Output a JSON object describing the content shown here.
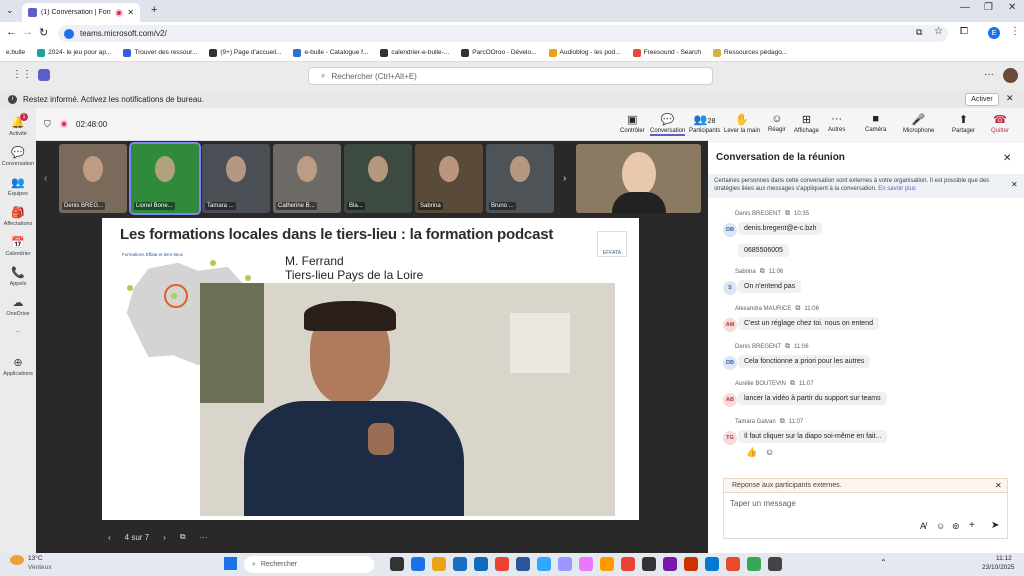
{
  "browser": {
    "tab_title": "(1) Conversation | Formatio",
    "new_tab": "+",
    "url": "teams.microsoft.com/v2/",
    "profile_initial": "E",
    "bookmarks": [
      {
        "label": "e.bulle",
        "color": "#ffffff"
      },
      {
        "label": "2024- le jeu pour ap...",
        "color": "#1aa3a3"
      },
      {
        "label": "Trouver des ressour...",
        "color": "#3b5bdb"
      },
      {
        "label": "(9+) Page d'accueil...",
        "color": "#333333"
      },
      {
        "label": "e-bulle - Catalogue f...",
        "color": "#2f6fd1"
      },
      {
        "label": "calendrier-e-bulle-...",
        "color": "#333333"
      },
      {
        "label": "ParcOOroo - Dévelo...",
        "color": "#333333"
      },
      {
        "label": "Audioblog - les pod...",
        "color": "#e8a317"
      },
      {
        "label": "Freesound - Search",
        "color": "#e84a2f"
      },
      {
        "label": "Ressources pédago...",
        "color": "#d8b04a"
      }
    ]
  },
  "teams": {
    "search_placeholder": "Rechercher (Ctrl+Alt+E)",
    "notification": "Restez informé. Activez les notifications de bureau.",
    "activate": "Activer",
    "rail": [
      {
        "label": "Activité",
        "icon": "bell-icon",
        "glyph": "🔔"
      },
      {
        "label": "Conversation",
        "icon": "chat-icon",
        "glyph": "💬"
      },
      {
        "label": "Équipes",
        "icon": "teams-icon",
        "glyph": "👥"
      },
      {
        "label": "Affectations",
        "icon": "assignments-icon",
        "glyph": "🎒"
      },
      {
        "label": "Calendrier",
        "icon": "calendar-icon",
        "glyph": "📅"
      },
      {
        "label": "Appels",
        "icon": "phone-icon",
        "glyph": "📞"
      },
      {
        "label": "OneDrive",
        "icon": "cloud-icon",
        "glyph": "☁"
      },
      {
        "label": "...",
        "icon": "more-icon",
        "glyph": ""
      },
      {
        "label": "Applications",
        "icon": "apps-icon",
        "glyph": "⊕"
      }
    ],
    "activity_badge": "1"
  },
  "meeting": {
    "timer": "02:48:00",
    "participants_count": "28",
    "toolbar": {
      "controller": "Contrôler",
      "conversation": "Conversation",
      "participants": "Participants",
      "raise_hand": "Lever la main",
      "react": "Réagir",
      "view": "Affichage",
      "more": "Autres",
      "camera": "Caméra",
      "microphone": "Microphone",
      "share": "Partager",
      "leave": "Quitter"
    },
    "thumbnails": [
      "Denis BREG...",
      "Lionel Bone...",
      "Tamara ...",
      "Catherine B...",
      "Bla...",
      "Sabrina",
      "Bruno ..."
    ],
    "slide": {
      "title": "Les formations locales dans le tiers-lieu : la formation podcast",
      "speaker": "M. Ferrand",
      "place": "Tiers-lieu Pays de la Loire",
      "map_caption": "Formations Effata et tiers-lieux",
      "logo": "EFFATA",
      "counter": "4 sur 7"
    }
  },
  "chat": {
    "title": "Conversation de la réunion",
    "banner": "Certaines personnes dans cette conversation sont externes à votre organisation. Il est possible que des stratégies liées aux messages s'appliquent à la conversation.",
    "learn_more": "En savoir plus",
    "messages": [
      {
        "sender": "Denis BREGENT",
        "time": "10:35",
        "initials": "DB",
        "text": "denis.bregent@e-c.bzh",
        "avatar": "#dde6f5",
        "fg": "#3b5ba8"
      },
      {
        "sender": "",
        "time": "",
        "initials": "",
        "text": "0685506005",
        "avatar": "",
        "fg": ""
      },
      {
        "sender": "Sabrina",
        "time": "11:06",
        "initials": "S",
        "text": "On n'entend pas",
        "avatar": "#dde6f5",
        "fg": "#3b5ba8"
      },
      {
        "sender": "Alexandra MAURICE",
        "time": "11:06",
        "initials": "AM",
        "text": "C'est un réglage chez toi. nous on entend",
        "avatar": "#f7dada",
        "fg": "#b23b3b"
      },
      {
        "sender": "Denis BREGENT",
        "time": "11:06",
        "initials": "DB",
        "text": "Cela fonctionne a priori pour les autres",
        "avatar": "#dde6f5",
        "fg": "#3b5ba8"
      },
      {
        "sender": "Aurélie BOUTEVIN",
        "time": "11:07",
        "initials": "AB",
        "text": "lancer la vidéo à partir du support sur teams",
        "avatar": "#f7dada",
        "fg": "#b23b3b"
      },
      {
        "sender": "Tamara Galvan",
        "time": "11:07",
        "initials": "TG",
        "text": "Il faut cliquer sur la diapo soi-même en fait...",
        "avatar": "#f7dada",
        "fg": "#b23b3b"
      }
    ],
    "reply_banner": "Réponse aux participants externes.",
    "compose_placeholder": "Taper un message"
  },
  "taskbar": {
    "temp": "13°C",
    "weather": "Venteux",
    "search": "Rechercher",
    "time": "11:12",
    "date": "23/10/2025"
  }
}
